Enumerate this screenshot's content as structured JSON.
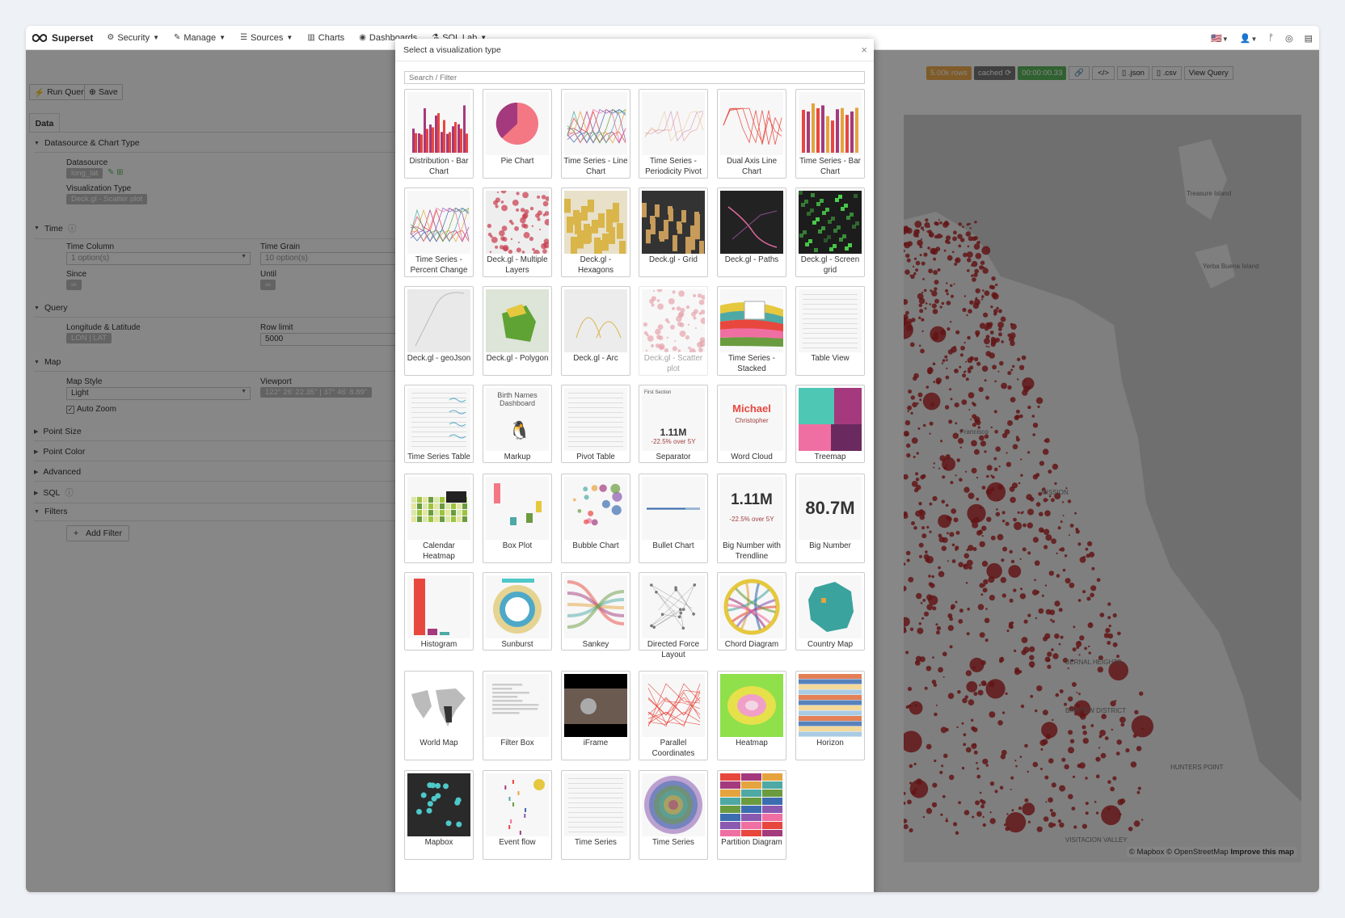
{
  "navbar": {
    "brand": "Superset",
    "items": [
      {
        "label": "Security",
        "icon": "cogs-icon",
        "caret": true
      },
      {
        "label": "Manage",
        "icon": "wrench-icon",
        "caret": true
      },
      {
        "label": "Sources",
        "icon": "database-icon",
        "caret": true
      },
      {
        "label": "Charts",
        "icon": "bar-chart-icon",
        "caret": false
      },
      {
        "label": "Dashboards",
        "icon": "dashboard-icon",
        "caret": false
      },
      {
        "label": "SQL Lab",
        "icon": "flask-icon",
        "caret": true
      }
    ]
  },
  "toolbar": {
    "run_query": "Run Query",
    "save": "Save"
  },
  "tabs": {
    "data": "Data"
  },
  "sections": {
    "datasource": "Datasource & Chart Type",
    "time": "Time",
    "query": "Query",
    "map": "Map",
    "point_size": "Point Size",
    "point_color": "Point Color",
    "advanced": "Advanced",
    "sql": "SQL",
    "filters": "Filters"
  },
  "fields": {
    "datasource_label": "Datasource",
    "datasource_value": "long_lat",
    "viz_type_label": "Visualization Type",
    "viz_type_value": "Deck.gl - Scatter plot",
    "time_column_label": "Time Column",
    "time_column_placeholder": "1 option(s)",
    "time_grain_label": "Time Grain",
    "time_grain_placeholder": "10 option(s)",
    "since_label": "Since",
    "since_value": "∞",
    "until_label": "Until",
    "until_value": "∞",
    "lonlat_label": "Longitude & Latitude",
    "lonlat_value": "LON | LAT",
    "row_limit_label": "Row limit",
    "row_limit_value": "5000",
    "map_style_label": "Map Style",
    "map_style_value": "Light",
    "viewport_label": "Viewport",
    "viewport_value": "122° 26' 22.35\" | 37° 46' 8.89\"",
    "auto_zoom_label": "Auto Zoom",
    "add_filter": "Add Filter"
  },
  "status": {
    "rows": "5.00k rows",
    "cached": "cached",
    "timer": "00:00:00.33",
    "json": ".json",
    "csv": ".csv",
    "view_query": "View Query",
    "colors": {
      "rows": "#f0ad4e",
      "cached": "#777777",
      "timer": "#5cb85c"
    }
  },
  "map": {
    "attribution": "© Mapbox © OpenStreetMap",
    "improve": "Improve this map",
    "labels": [
      "Treasure Island",
      "Yerba Buena Island",
      "Francisco",
      "MISSION",
      "BERNAL HEIGHTS",
      "BAYVIEW DISTRICT",
      "HUNTERS POINT",
      "VISITACION VALLEY"
    ]
  },
  "modal": {
    "title": "Select a visualization type",
    "close": "×",
    "search_placeholder": "Search / Filter",
    "tiles": [
      {
        "name": "Distribution - Bar Chart",
        "thumb": "dist-bar"
      },
      {
        "name": "Pie Chart",
        "thumb": "pie"
      },
      {
        "name": "Time Series - Line Chart",
        "thumb": "lines"
      },
      {
        "name": "Time Series - Periodicity Pivot",
        "thumb": "lines-light"
      },
      {
        "name": "Dual Axis Line Chart",
        "thumb": "dual"
      },
      {
        "name": "Time Series - Bar Chart",
        "thumb": "ts-bar"
      },
      {
        "name": "Time Series - Percent Change",
        "thumb": "lines"
      },
      {
        "name": "Deck.gl - Multiple Layers",
        "thumb": "map-red"
      },
      {
        "name": "Deck.gl - Hexagons",
        "thumb": "hex"
      },
      {
        "name": "Deck.gl - Grid",
        "thumb": "grid3d"
      },
      {
        "name": "Deck.gl - Paths",
        "thumb": "paths"
      },
      {
        "name": "Deck.gl - Screen grid",
        "thumb": "screengrid"
      },
      {
        "name": "Deck.gl - geoJson",
        "thumb": "geojson"
      },
      {
        "name": "Deck.gl - Polygon",
        "thumb": "polygon"
      },
      {
        "name": "Deck.gl - Arc",
        "thumb": "arc"
      },
      {
        "name": "Deck.gl - Scatter plot",
        "thumb": "map-red",
        "disabled": true
      },
      {
        "name": "Time Series - Stacked",
        "thumb": "stacked"
      },
      {
        "name": "Table View",
        "thumb": "table"
      },
      {
        "name": "Time Series Table",
        "thumb": "tstable"
      },
      {
        "name": "Markup",
        "thumb": "markup",
        "thumb_text": "Birth Names Dashboard"
      },
      {
        "name": "Pivot Table",
        "thumb": "table"
      },
      {
        "name": "Separator",
        "thumb": "separator",
        "thumb_text": "1.11M",
        "thumb_sub": "-22.5% over 5Y",
        "thumb_head": "First Section"
      },
      {
        "name": "Word Cloud",
        "thumb": "wordcloud",
        "thumb_text": "Michael",
        "thumb_sub": "Christopher"
      },
      {
        "name": "Treemap",
        "thumb": "treemap"
      },
      {
        "name": "Calendar Heatmap",
        "thumb": "calendar"
      },
      {
        "name": "Box Plot",
        "thumb": "boxplot"
      },
      {
        "name": "Bubble Chart",
        "thumb": "bubble"
      },
      {
        "name": "Bullet Chart",
        "thumb": "bullet"
      },
      {
        "name": "Big Number with Trendline",
        "thumb": "bignum",
        "thumb_text": "1.11M",
        "thumb_sub": "-22.5% over 5Y"
      },
      {
        "name": "Big Number",
        "thumb": "bignum2",
        "thumb_text": "80.7M"
      },
      {
        "name": "Histogram",
        "thumb": "histogram"
      },
      {
        "name": "Sunburst",
        "thumb": "sunburst"
      },
      {
        "name": "Sankey",
        "thumb": "sankey"
      },
      {
        "name": "Directed Force Layout",
        "thumb": "force"
      },
      {
        "name": "Chord Diagram",
        "thumb": "chord"
      },
      {
        "name": "Country Map",
        "thumb": "country"
      },
      {
        "name": "World Map",
        "thumb": "worldmap"
      },
      {
        "name": "Filter Box",
        "thumb": "filterbox"
      },
      {
        "name": "iFrame",
        "thumb": "iframe"
      },
      {
        "name": "Parallel Coordinates",
        "thumb": "parallel"
      },
      {
        "name": "Heatmap",
        "thumb": "heatmap"
      },
      {
        "name": "Horizon",
        "thumb": "horizon"
      },
      {
        "name": "Mapbox",
        "thumb": "mapbox"
      },
      {
        "name": "Event flow",
        "thumb": "eventflow"
      },
      {
        "name": "Time Series",
        "thumb": "table"
      },
      {
        "name": "Time Series",
        "thumb": "rose"
      },
      {
        "name": "Partition Diagram",
        "thumb": "partition"
      }
    ]
  }
}
